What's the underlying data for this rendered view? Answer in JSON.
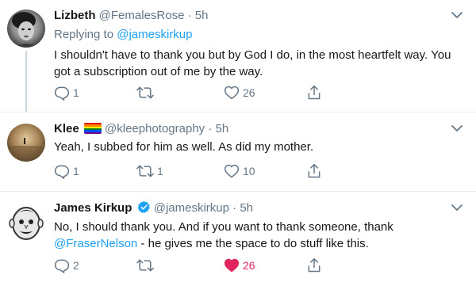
{
  "tweets": [
    {
      "name": "Lizbeth",
      "handle": "@FemalesRose",
      "dot": "·",
      "time": "5h",
      "replying_prefix": "Replying to",
      "replying_to": "@jameskirkup",
      "text": "I shouldn't have to thank you but by God I do, in the most heartfelt way.  You got a subscription out of me by the way.",
      "replies": "1",
      "retweets": "",
      "likes": "26"
    },
    {
      "name": "Klee",
      "handle": "@kleephotography",
      "dot": "·",
      "time": "5h",
      "text": "Yeah, I subbed for him as well. As did my mother.",
      "replies": "1",
      "retweets": "1",
      "likes": "10"
    },
    {
      "name": "James Kirkup",
      "handle": "@jameskirkup",
      "dot": "·",
      "time": "5h",
      "text_a": "No, I should thank you.  And if you want to thank someone, thank",
      "mention": "@FraserNelson",
      "text_b": " - he gives me the space to do stuff like this.",
      "replies": "2",
      "retweets": "",
      "likes": "26",
      "liked": true
    }
  ],
  "colors": {
    "link": "#1da1f2",
    "muted": "#657786",
    "like_active": "#e0245e",
    "verified": "#1da1f2"
  },
  "icons": [
    "reply-icon",
    "retweet-icon",
    "like-icon",
    "share-icon",
    "chevron-down-icon",
    "verified-badge-icon",
    "rainbow-flag-icon"
  ]
}
